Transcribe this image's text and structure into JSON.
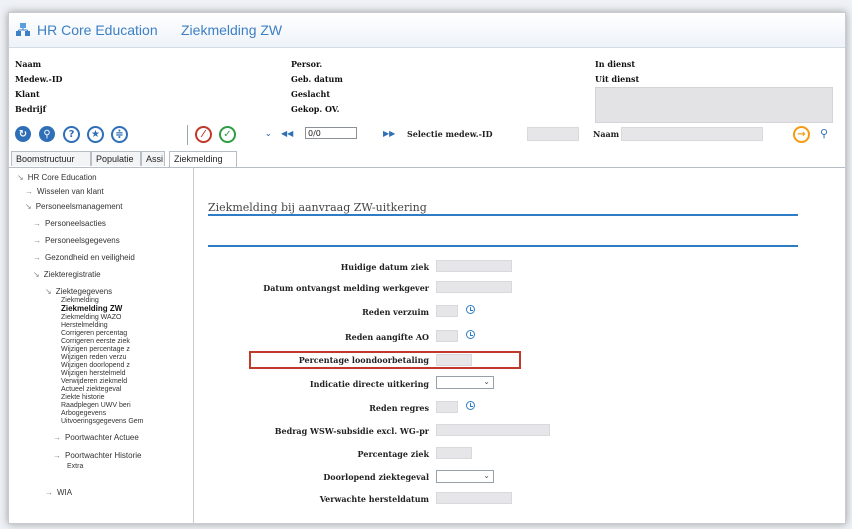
{
  "app": {
    "title": "HR Core Education",
    "screen_title": "Ziekmelding ZW"
  },
  "header": {
    "col1": [
      "Naam",
      "Medew.-ID",
      "Klant",
      "Bedrijf"
    ],
    "col2": [
      "Persor.",
      "Geb. datum",
      "Geslacht",
      "Gekop. OV."
    ],
    "col3": [
      "In dienst",
      "Uit dienst"
    ]
  },
  "toolbar": {
    "page_value": "0/0",
    "selectie_label": "Selectie medew.-ID",
    "naam_label": "Naam"
  },
  "tabs": [
    "Boomstructuur",
    "Populatie",
    "Assi",
    "Ziekmelding"
  ],
  "tree": {
    "root": "HR Core Education",
    "wisselen": "Wisselen van klant",
    "personeelsmanagement": "Personeelsmanagement",
    "personeelsacties": "Personeelsacties",
    "personeelsgegevens": "Personeelsgegevens",
    "gezondheid": "Gezondheid en veiligheid",
    "ziekteregistratie": "Ziekteregistratie",
    "ziektegegevens": "Ziektegegevens",
    "leaves": [
      "Ziekmelding",
      "Ziekmelding ZW",
      "Ziekmelding WAZO",
      "Herstelmelding",
      "Corrigeren percentag",
      "Corrigeren eerste ziek",
      "Wijzigen percentage z",
      "Wijzigen reden verzu",
      "Wijzigen doorlopend z",
      "Wijzigen herstelmeld",
      "Verwijderen ziekmeld",
      "Actueel ziektegeval",
      "Ziekte historie",
      "Raadplegen UWV beri",
      "Arbogegevens",
      "Uitvoeringsgegevens Gem"
    ],
    "poortwachter_actueel": "Poortwachter Actuee",
    "poortwachter_historie": "Poortwachter Historie",
    "extra": "Extra",
    "wia": "WIA"
  },
  "form": {
    "section_title": "Ziekmelding bij aanvraag ZW-uitkering",
    "fields": [
      "Huidige datum ziek",
      "Datum ontvangst melding werkgever",
      "Reden verzuim",
      "Reden aangifte AO",
      "Percentage loondoorbetaling",
      "Indicatie directe uitkering",
      "Reden regres",
      "Bedrag WSW-subsidie excl. WG-pr",
      "Percentage ziek",
      "Doorlopend ziektegeval",
      "Verwachte hersteldatum"
    ]
  },
  "colors": {
    "accent": "#3d7fc4",
    "highlight": "#c0392b",
    "field_bg": "#e6e6e9"
  }
}
